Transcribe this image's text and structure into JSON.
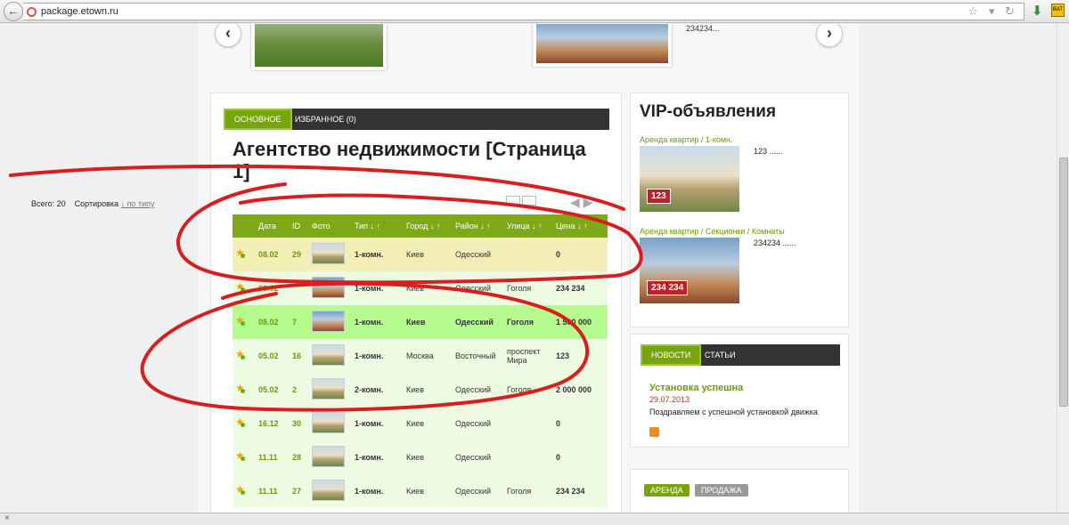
{
  "browser": {
    "url": "package.etown.ru",
    "back_symbol": "←",
    "dl_symbol": "⬇",
    "ext_label": "BAT"
  },
  "slider": {
    "caption": "234234..."
  },
  "main": {
    "tabs": [
      {
        "label": "ОСНОВНОЕ"
      },
      {
        "label": "ИЗБРАННОЕ (0)"
      }
    ],
    "title": "Агентство недвижимости [Страница 1]",
    "total": "Всего: 20",
    "sort_label": "Сортировка",
    "sort_link": "↓ по типу",
    "columns": [
      "Дата",
      "ID",
      "Фото",
      "Тип ↓ ↑",
      "Город ↓ ↑",
      "Район ↓ ↑",
      "Улица ↓ ↑",
      "Цена ↓ ↑"
    ],
    "rows": [
      {
        "date": "08.02",
        "id": "29",
        "type": "1-комн.",
        "city": "Киев",
        "district": "Одесский",
        "street": "",
        "price": "0"
      },
      {
        "date": "08.02",
        "id": "",
        "type": "1-комн.",
        "city": "Киев",
        "district": "Одесский",
        "street": "Гоголя",
        "price": "234 234"
      },
      {
        "date": "08.02",
        "id": "7",
        "type": "1-комн.",
        "city": "Киев",
        "district": "Одесский",
        "street": "Гоголя",
        "price": "1 500 000"
      },
      {
        "date": "05.02",
        "id": "16",
        "type": "1-комн.",
        "city": "Москва",
        "district": "Восточный",
        "street": "проспект Мира",
        "price": "123"
      },
      {
        "date": "05.02",
        "id": "2",
        "type": "2-комн.",
        "city": "Киев",
        "district": "Одесский",
        "street": "Гоголя",
        "price": "2 000 000"
      },
      {
        "date": "16.12",
        "id": "30",
        "type": "1-комн.",
        "city": "Киев",
        "district": "Одесский",
        "street": "",
        "price": "0"
      },
      {
        "date": "11.11",
        "id": "28",
        "type": "1-комн.",
        "city": "Киев",
        "district": "Одесский",
        "street": "",
        "price": "0"
      },
      {
        "date": "11.11",
        "id": "27",
        "type": "1-комн.",
        "city": "Киев",
        "district": "Одесский",
        "street": "Гоголя",
        "price": "234 234"
      }
    ]
  },
  "vip": {
    "title": "VIP-объявления",
    "items": [
      {
        "link": "Аренда квартир / 1-комн.",
        "price": "123",
        "text": "123 ......"
      },
      {
        "link": "Аренда квартир / Секционки / Комнаты",
        "price": "234 234",
        "text": "234234 ......"
      }
    ]
  },
  "news": {
    "tabs": [
      {
        "label": "НОВОСТИ"
      },
      {
        "label": "СТАТЬИ"
      }
    ],
    "title": "Установка успешна",
    "date": "29.07.2013",
    "body": "Поздравляем с успешной установкой движка"
  },
  "rent": {
    "tabs": [
      {
        "label": "АРЕНДА"
      },
      {
        "label": "ПРОДАЖА"
      }
    ]
  },
  "colors": {
    "accent": "#78a40e",
    "dark": "#333333",
    "marker": "#d81e1e",
    "price_badge": "#c0202a"
  }
}
